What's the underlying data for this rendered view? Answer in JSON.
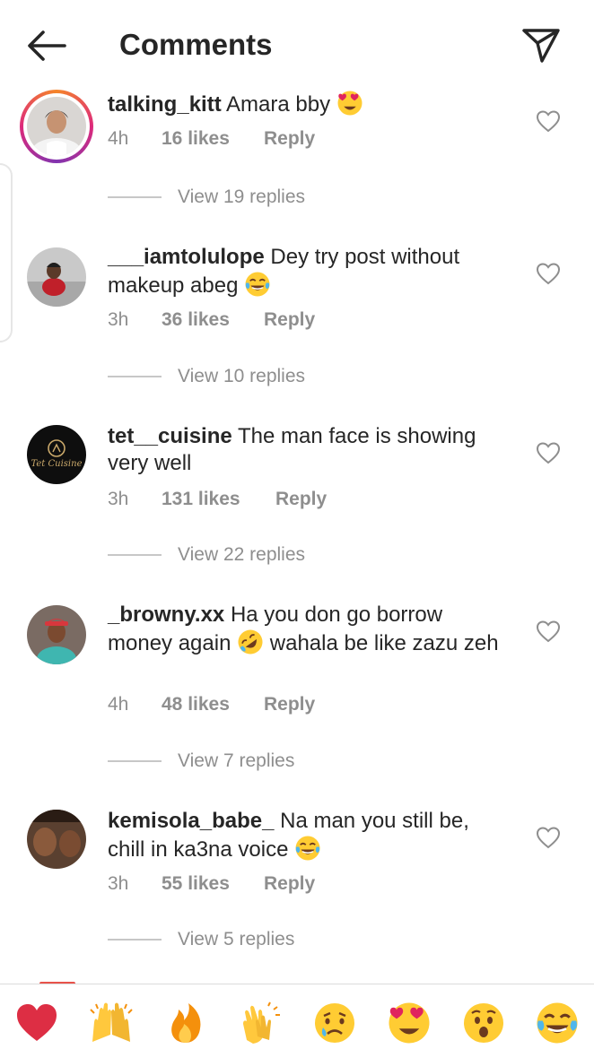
{
  "header": {
    "title": "Comments"
  },
  "comments": [
    {
      "username": "talking_kitt",
      "text": "Amara bby",
      "emoji": "heart-eyes",
      "time": "4h",
      "likes": "16 likes",
      "reply": "Reply",
      "replies": "View 19 replies",
      "story": true
    },
    {
      "username": "___iamtolulope",
      "text": "Dey try post without makeup abeg",
      "emoji": "tears-of-joy",
      "time": "3h",
      "likes": "36 likes",
      "reply": "Reply",
      "replies": "View 10 replies"
    },
    {
      "username": "tet__cuisine",
      "text": "The man face is showing very well",
      "time": "3h",
      "likes": "131 likes",
      "reply": "Reply",
      "replies": "View 22 replies",
      "logo": "Tet Cuisine"
    },
    {
      "username": "_browny.xx",
      "text_a": "Ha you don go borrow money again",
      "emoji": "rolling-laughing",
      "text_b": "wahala be like zazu zeh",
      "time": "4h",
      "likes": "48 likes",
      "reply": "Reply",
      "replies": "View 7 replies"
    },
    {
      "username": "kemisola_babe_",
      "text": "Na man you still be, chill in ka3na voice",
      "emoji": "tears-of-joy",
      "time": "3h",
      "likes": "55 likes",
      "reply": "Reply",
      "replies": "View 5 replies"
    }
  ],
  "quick_reactions": [
    "red-heart",
    "raising-hands",
    "fire",
    "clapping-hands",
    "crying-face",
    "heart-eyes",
    "surprised-face",
    "tears-of-joy"
  ],
  "colors": {
    "text": "#262626",
    "muted": "#8e8e8e",
    "heart": "#e0245e",
    "emoji_yellow": "#ffcc33"
  }
}
